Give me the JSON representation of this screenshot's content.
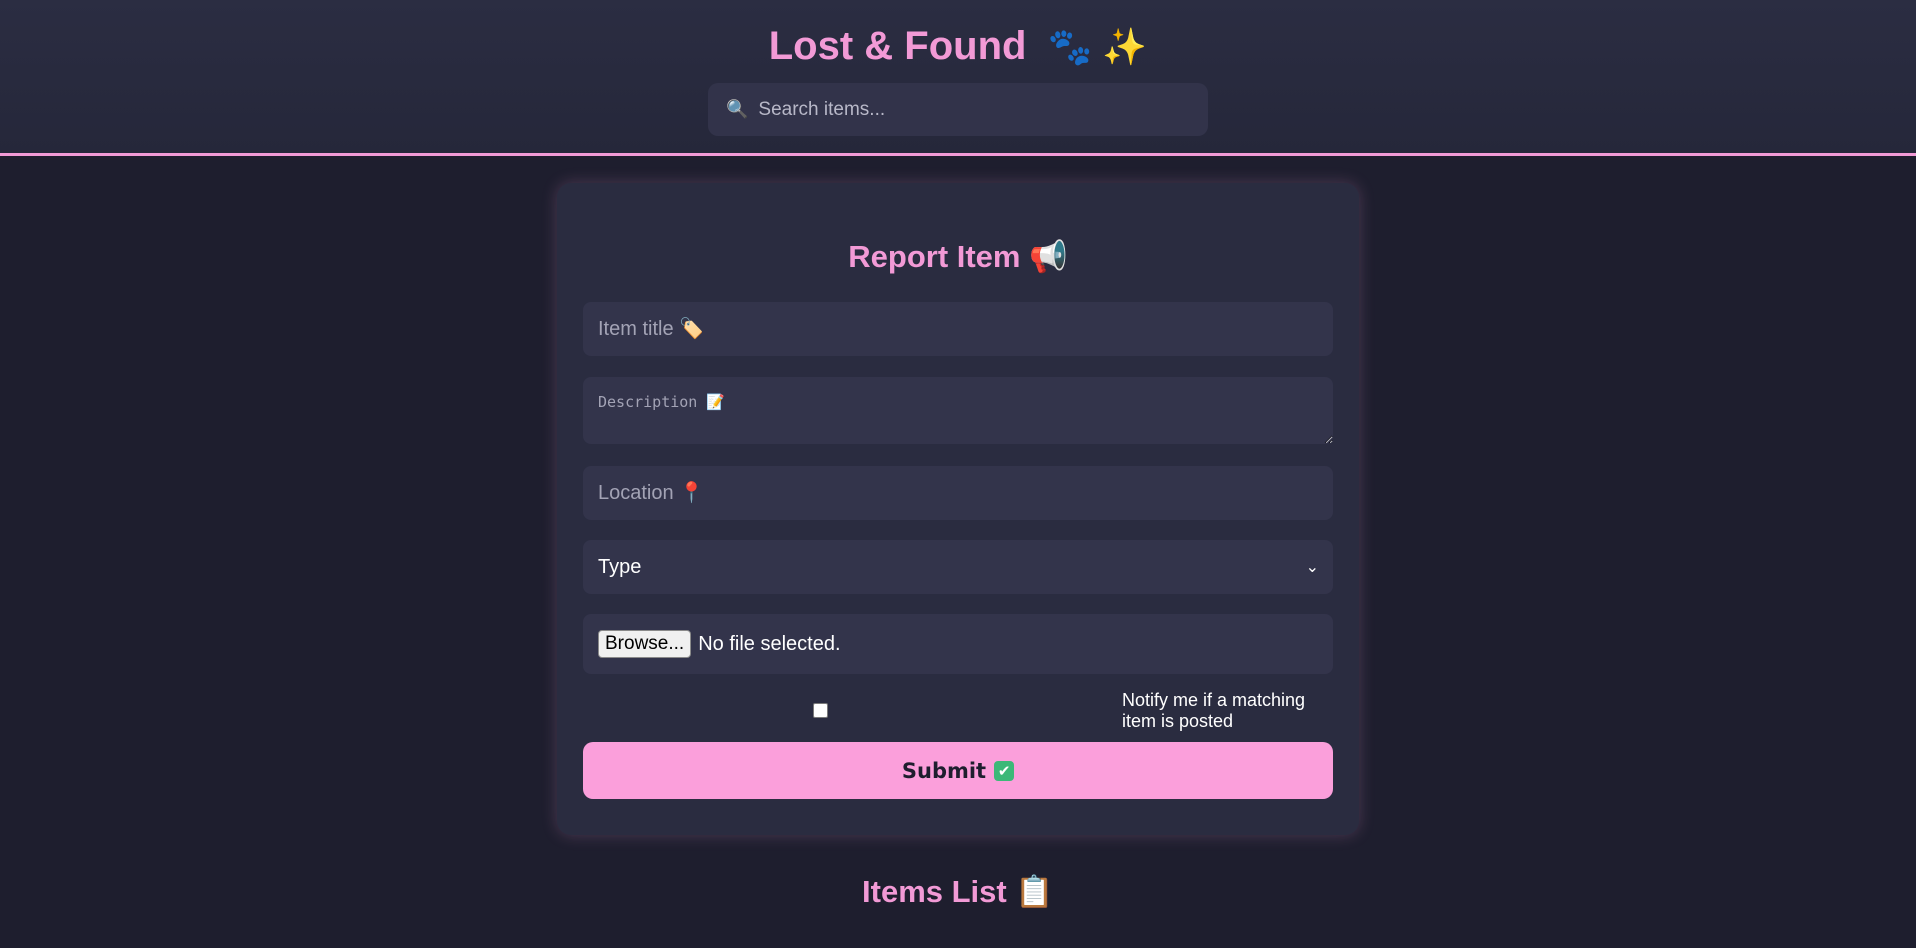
{
  "header": {
    "title": "Lost & Found",
    "title_emoji": "🐾 ✨",
    "search": {
      "placeholder": "Search items...",
      "value": ""
    }
  },
  "report_form": {
    "title": "Report Item",
    "title_emoji": "📢",
    "item_title_placeholder": "Item title 🏷️",
    "description_placeholder": "Description 📝",
    "location_placeholder": "Location 📍",
    "type_selected": "Type",
    "file": {
      "button_label": "Browse...",
      "status": "No file selected."
    },
    "notify": {
      "label": "Notify me if a matching item is posted",
      "checked": false
    },
    "submit_label": "Submit",
    "submit_emoji": "✔"
  },
  "items_list": {
    "title": "Items List",
    "title_emoji": "📋"
  },
  "colors": {
    "accent": "#f29ad6",
    "submit_bg": "#fb9fdb",
    "background": "#1e1e2e",
    "card": "#2a2c40",
    "field": "#33344b"
  }
}
